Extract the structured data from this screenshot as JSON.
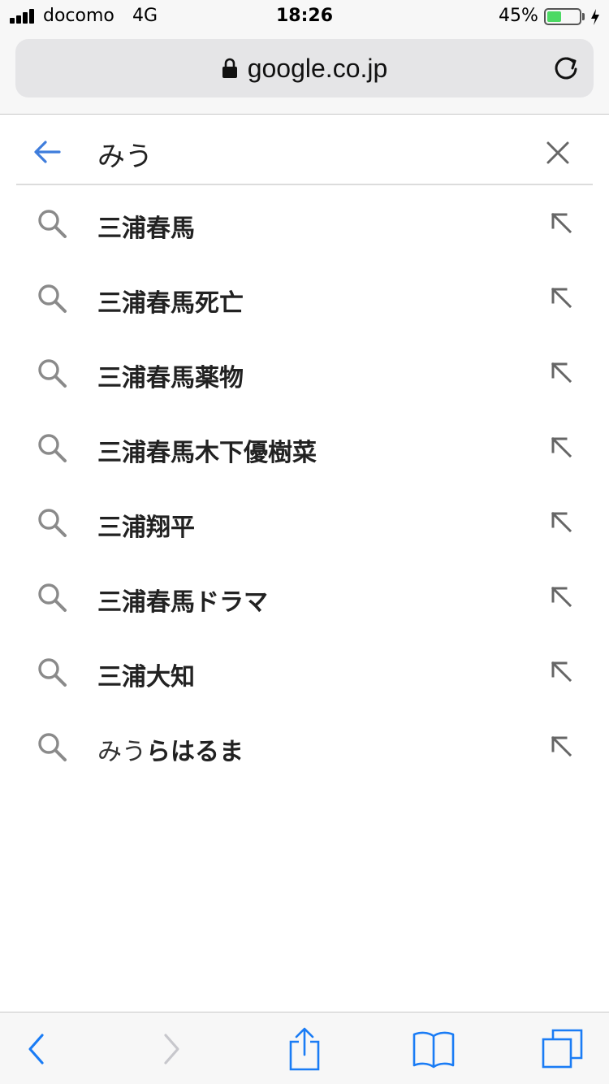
{
  "status_bar": {
    "carrier": "docomo",
    "network": "4G",
    "time": "18:26",
    "battery_percent_text": "45%",
    "battery_level": 0.45
  },
  "url_bar": {
    "domain": "google.co.jp",
    "lock_icon": "lock-icon",
    "reload_icon": "reload-icon"
  },
  "search": {
    "query": "みう",
    "back_icon": "arrow-left-icon",
    "clear_icon": "close-icon"
  },
  "suggestions": [
    {
      "typed": "",
      "rest": "三浦春馬"
    },
    {
      "typed": "",
      "rest": "三浦春馬死亡"
    },
    {
      "typed": "",
      "rest": "三浦春馬薬物"
    },
    {
      "typed": "",
      "rest": "三浦春馬木下優樹菜"
    },
    {
      "typed": "",
      "rest": "三浦翔平"
    },
    {
      "typed": "",
      "rest": "三浦春馬ドラマ"
    },
    {
      "typed": "",
      "rest": "三浦大知"
    },
    {
      "typed": "みう",
      "rest": "らはるま"
    }
  ],
  "toolbar": {
    "back_icon": "chevron-left-icon",
    "forward_icon": "chevron-right-icon",
    "share_icon": "share-icon",
    "bookmarks_icon": "book-icon",
    "tabs_icon": "tabs-icon"
  },
  "colors": {
    "accent_blue": "#3f7ddc",
    "safari_blue": "#1a7cf5",
    "gray_icon": "#8a8a8a",
    "battery_green": "#4cd964"
  }
}
